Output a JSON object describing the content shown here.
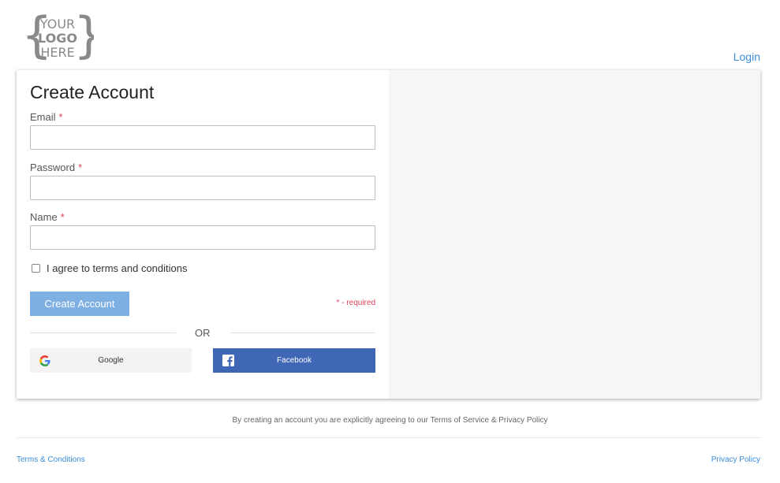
{
  "header": {
    "logo": {
      "lines": [
        "YOUR",
        "LOGO",
        "HERE"
      ]
    },
    "login_label": "Login"
  },
  "form": {
    "title": "Create Account",
    "email_label": "Email",
    "password_label": "Password",
    "name_label": "Name",
    "required_marker": "*",
    "agree_label": "I agree to terms and conditions",
    "agree_checked": false,
    "submit_label": "Create Account",
    "required_note": "* - required",
    "or_label": "OR",
    "google_label": "Google",
    "facebook_label": "Facebook"
  },
  "footer": {
    "agreement": "By creating an account you are explicitly agreeing to our Terms of Service & Privacy Policy",
    "terms_label": "Terms & Conditions",
    "privacy_label": "Privacy Policy"
  },
  "colors": {
    "accent": "#3a8dd8",
    "button": "#7fb0e3",
    "required": "#e0405a",
    "facebook": "#3f67b5"
  },
  "icons": {
    "google": "google-icon",
    "facebook": "facebook-icon"
  }
}
